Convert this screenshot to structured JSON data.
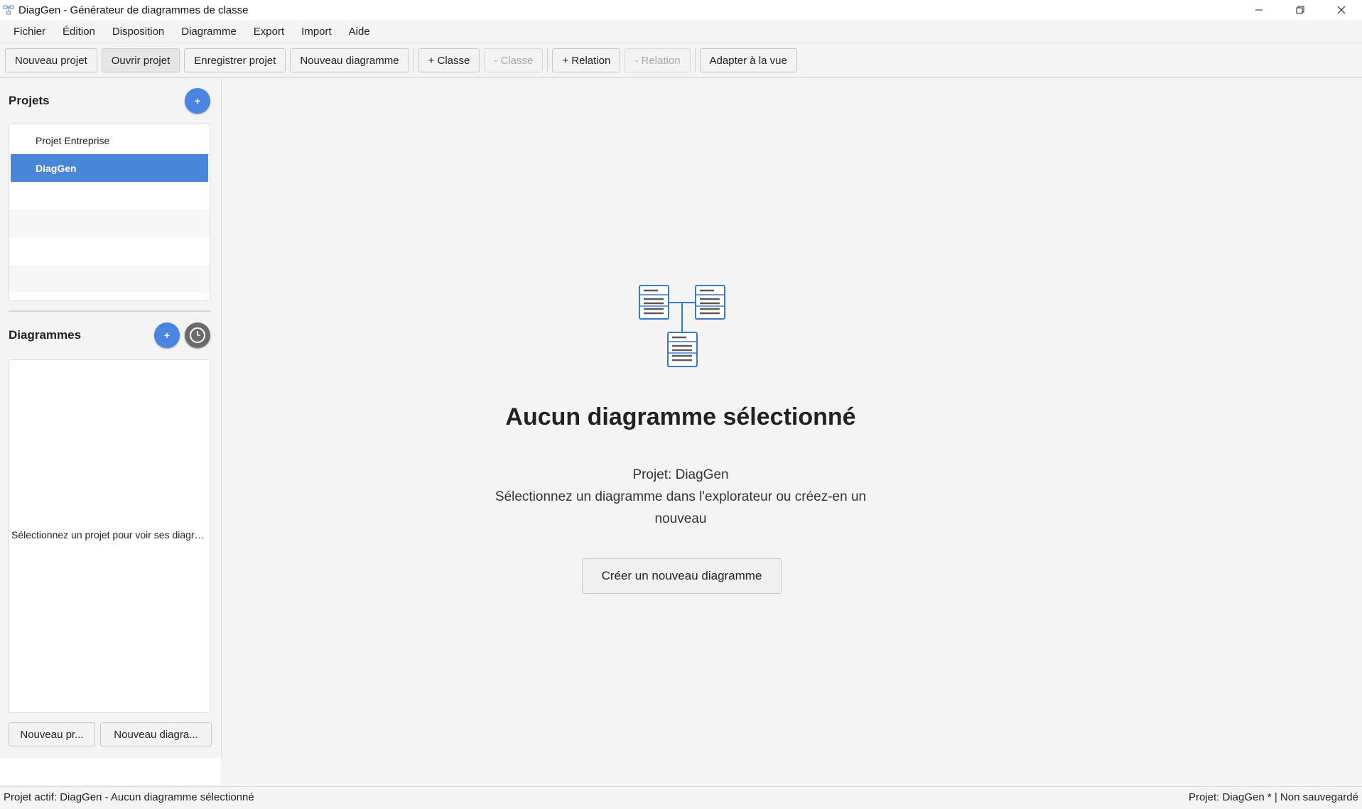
{
  "window": {
    "title": "DiagGen - Générateur de diagrammes de classe",
    "controls": [
      "minimize-icon",
      "restore-icon",
      "close-icon"
    ]
  },
  "menu": [
    "Fichier",
    "Édition",
    "Disposition",
    "Diagramme",
    "Export",
    "Import",
    "Aide"
  ],
  "toolbar": {
    "new_project": "Nouveau projet",
    "open_project": "Ouvrir projet",
    "save_project": "Enregistrer projet",
    "new_diagram": "Nouveau diagramme",
    "add_class": "+ Classe",
    "remove_class": "- Classe",
    "add_relation": "+ Relation",
    "remove_relation": "- Relation",
    "fit_view": "Adapter à la vue"
  },
  "sidebar": {
    "projects_header": "Projets",
    "add_project_symbol": "+",
    "projects": [
      "Projet Entreprise",
      "DiagGen"
    ],
    "selected_project": "DiagGen",
    "diagrams_header": "Diagrammes",
    "add_diagram_symbol": "+",
    "diagrams_empty_text": "Sélectionnez un projet pour voir ses diagrammes",
    "new_project_btn": "Nouveau pr...",
    "new_diagram_btn": "Nouveau diagra..."
  },
  "main": {
    "title": "Aucun diagramme sélectionné",
    "project_line": "Projet: DiagGen",
    "hint_line1": "Sélectionnez un diagramme dans l'explorateur ou créez-en un",
    "hint_line2": "nouveau",
    "create_button": "Créer un nouveau diagramme"
  },
  "status": {
    "left": "Projet actif: DiagGen - Aucun diagramme sélectionné",
    "right": "Projet: DiagGen * | Non sauvegardé"
  },
  "colors": {
    "accent": "#4a86e0",
    "selection": "#4a86d8",
    "icon_blue": "#3b78c8"
  }
}
